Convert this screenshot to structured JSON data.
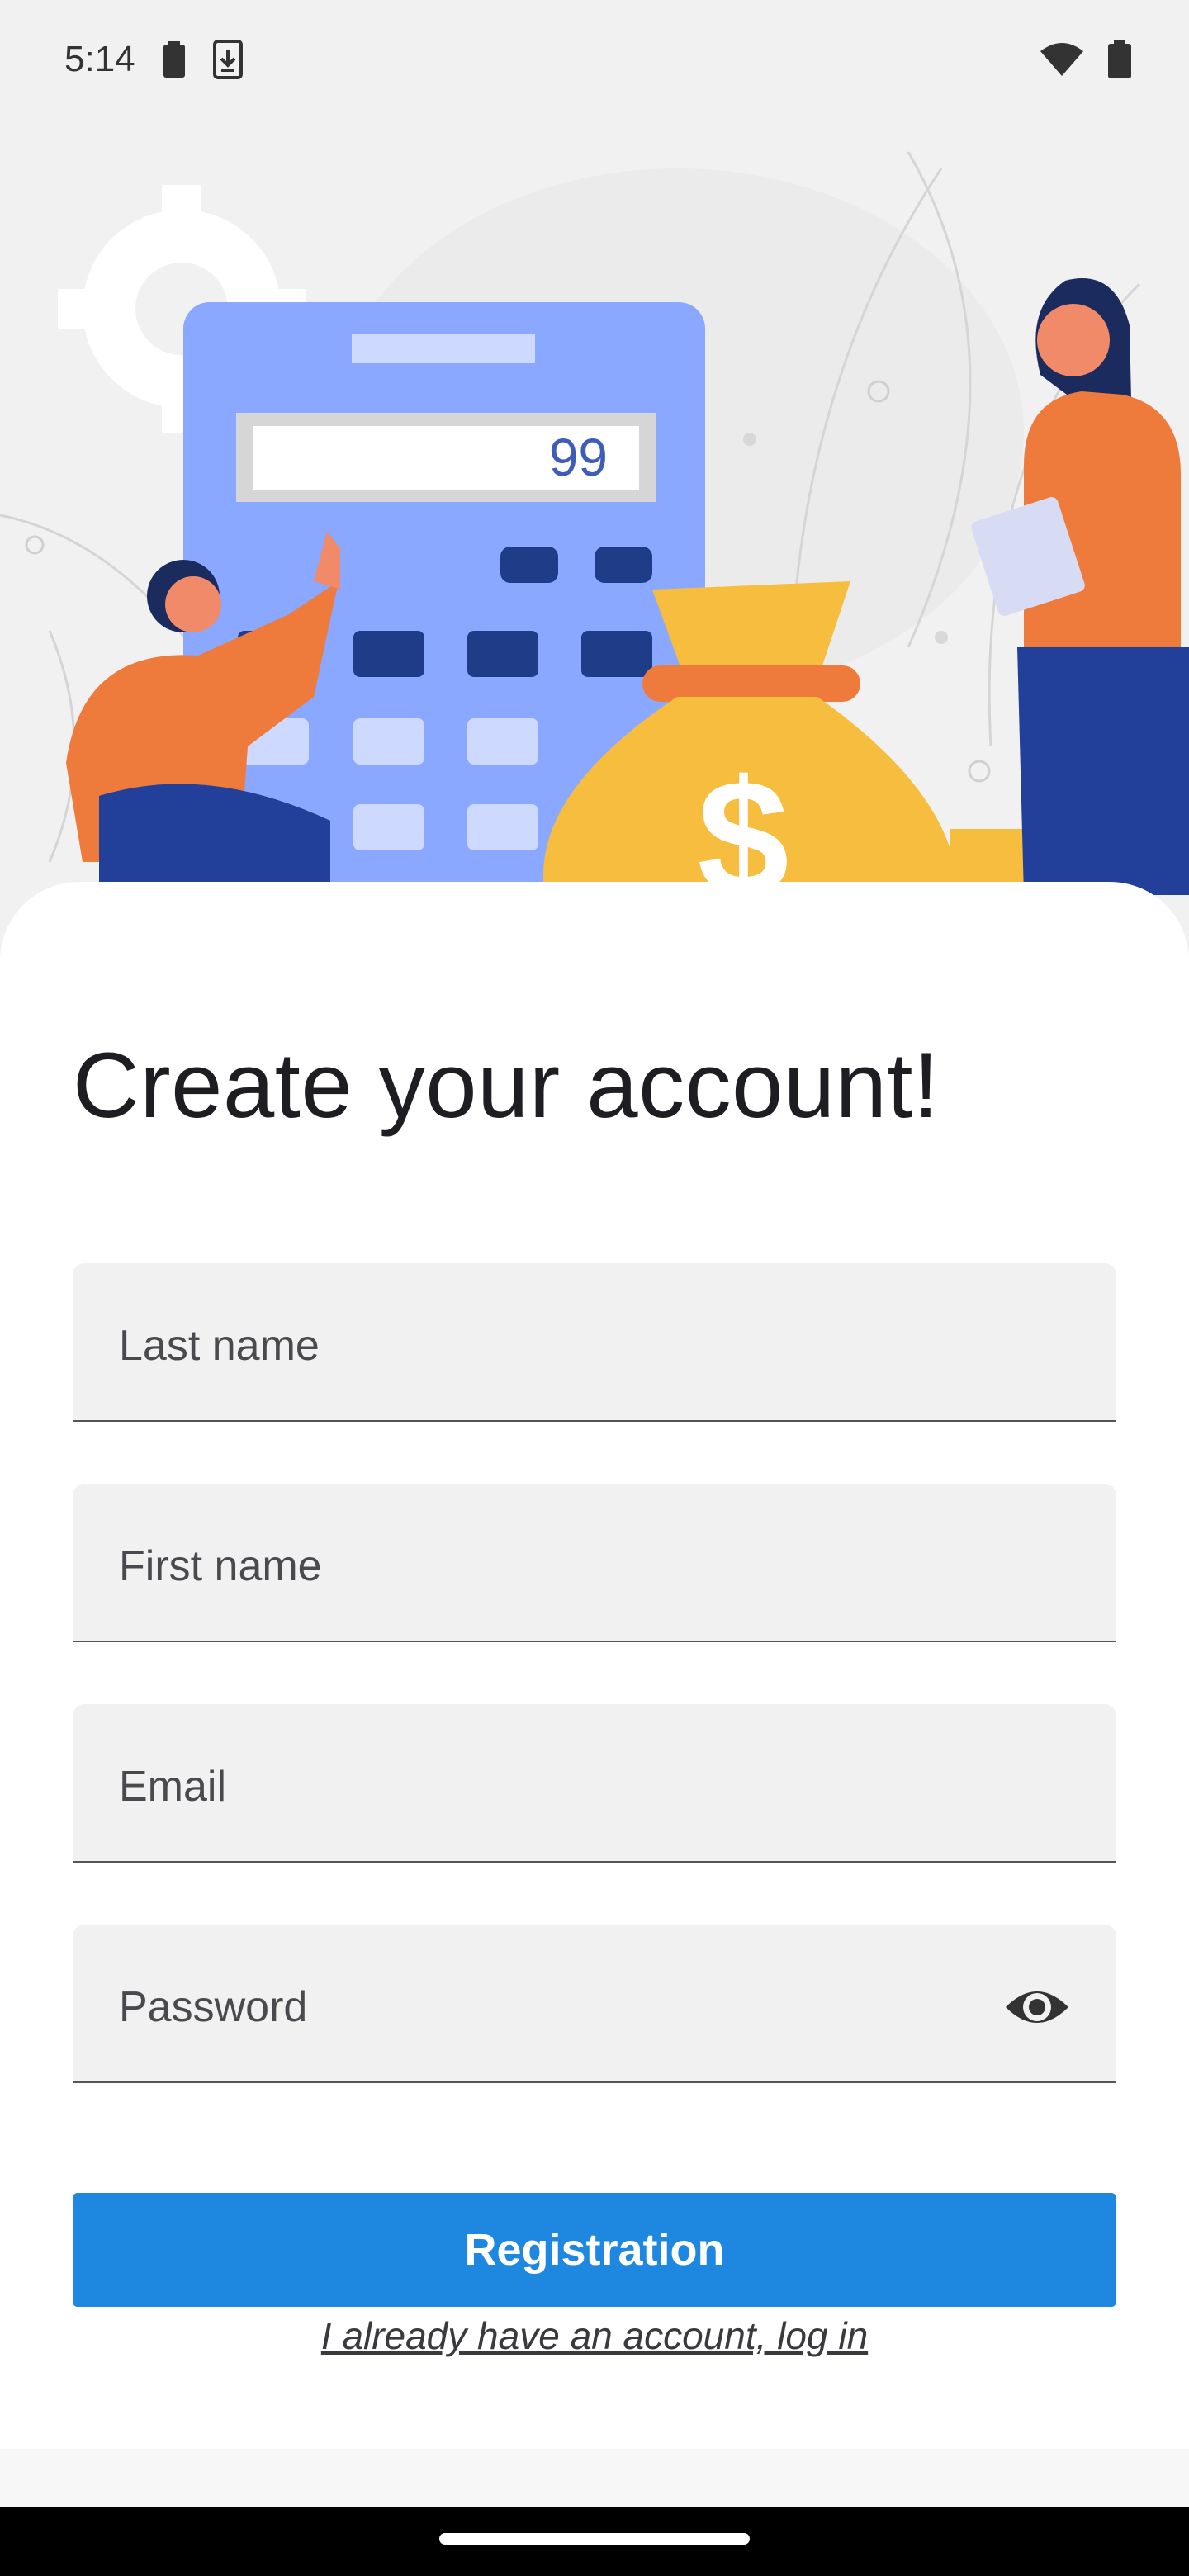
{
  "status_bar": {
    "time": "5:14",
    "icons": [
      "battery-icon",
      "download-icon",
      "wifi-icon",
      "battery-icon"
    ]
  },
  "illustration": {
    "calculator_display": "99",
    "colors": {
      "calculator": "#8aa8ff",
      "keys_dark": "#1f3c88",
      "keys_light": "#cdd9ff",
      "shirt": "#ee7a3c",
      "pants": "#22409a",
      "money_bag": "#f6bd3f"
    }
  },
  "form": {
    "title": "Create your account!",
    "fields": [
      {
        "label": "Last name"
      },
      {
        "label": "First name"
      },
      {
        "label": "Email"
      },
      {
        "label": "Password",
        "icon": "eye-icon"
      }
    ],
    "submit_label": "Registration",
    "login_link": "I already have an account, log in"
  },
  "colors": {
    "accent": "#1e88e0",
    "field_bg": "#f1f1f1",
    "text": "#1d1d22"
  }
}
